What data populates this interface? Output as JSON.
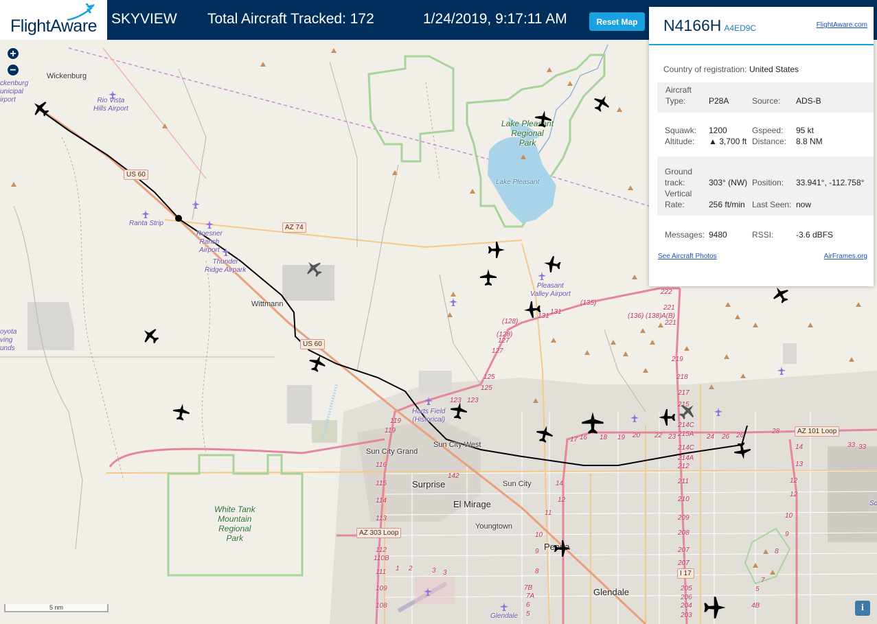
{
  "header": {
    "logo_text": "FlightAware",
    "app_name": "SKYVIEW",
    "tracked_label": "Total Aircraft Tracked: 172",
    "datetime": "1/24/2019, 9:17:11 AM",
    "reset_label": "Reset Map"
  },
  "map": {
    "zoom_in": "+",
    "zoom_out": "−",
    "scale_label": "5 nm",
    "info_label": "i",
    "places": {
      "wickenburg": "Wickenburg",
      "wickenburg_airport": "ckenburg\nunicipal\nirport",
      "rio_vista": "Rio Vista\nHills Airport",
      "lake_pleasant_park": "Lake Pleasant\nRegional\nPark",
      "lake_pleasant": "Lake Pleasant",
      "ranta": "Ranta Strip",
      "roesner": "Roesner\nRanch\nAirport",
      "thunder": "Thunder\nRidge Airpark",
      "wittmann": "Wittmann",
      "pleasant_valley": "Pleasant\nValley Airport",
      "coyota": "oyota\nving\nunds",
      "harts": "Harts Field\n(Historical)",
      "sun_city_grand": "Sun City Grand",
      "sun_city_west": "Sun City West",
      "surprise": "Surprise",
      "sun_city": "Sun City",
      "el_mirage": "El Mirage",
      "youngtown": "Youngtown",
      "white_tank": "White Tank\nMountain\nRegional\nPark",
      "peoria": "Peoria",
      "glendale": "Glendale",
      "glendale_airport": "Glendale",
      "sc": "Sc"
    },
    "shields": {
      "us60_a": "US 60",
      "az74": "AZ 74",
      "us60_b": "US 60",
      "az101": "AZ 101 Loop",
      "az303": "AZ 303 Loop",
      "i17": "I 17"
    },
    "exits": {
      "e135": "(135)",
      "e136": "(136)",
      "e138": "(138)",
      "eAB": "A(B)",
      "e131a": "131",
      "e131b": "131",
      "e128a": "(128)",
      "e128b": "(128)",
      "e127a": "127",
      "e127b": "127",
      "e125a": "125",
      "e125b": "125",
      "e123a": "123",
      "e123b": "123",
      "e119a": "119",
      "e119b": "119",
      "e116": "116",
      "e115": "115",
      "e114": "114",
      "e113": "113",
      "e112": "112",
      "e110b": "110B",
      "e111": "111",
      "e109": "109",
      "e108": "108",
      "e142": "142",
      "e1": "1",
      "e2": "2",
      "e3a": "3",
      "e3b": "3",
      "e17": "17",
      "e16": "16",
      "e18": "18",
      "e19": "19",
      "e20": "20",
      "e22": "22",
      "e23": "23",
      "e24": "24",
      "e26a": "26",
      "e26b": "26",
      "e28": "28",
      "e33a": "33",
      "e33b": "33",
      "e14a": "14",
      "e14b": "14",
      "e13": "13",
      "e12a": "12",
      "e12b": "12",
      "e10": "10",
      "e9": "9",
      "e8a": "8",
      "e7": "7",
      "e5": "5",
      "e4b": "4B",
      "e222": "222",
      "e221a": "221",
      "e221b": "221",
      "e219": "219",
      "e218": "218",
      "e217": "217",
      "e215": "215",
      "e214c": "214C",
      "e215a": "215A",
      "e214c2": "214C",
      "e214a": "214A",
      "e212": "212",
      "e211": "211",
      "e210": "210",
      "e209": "209",
      "e208": "208",
      "e207a": "207",
      "e207b": "207",
      "e206": "206",
      "e205": "205",
      "e204": "204",
      "e203": "203",
      "p14": "14",
      "p12": "12",
      "p11": "11",
      "p10": "10",
      "p9": "9",
      "p8": "8",
      "p7b": "7B",
      "p7a": "7A",
      "p6": "6",
      "p5": "5"
    }
  },
  "panel": {
    "registration": "N4166H",
    "hex": "A4ED9C",
    "fa_link": "FlightAware.com",
    "country_label": "Country of registration:",
    "country_value": "United States",
    "aircraft_type_label": "Aircraft\nType:",
    "aircraft_type_value": "P28A",
    "source_label": "Source:",
    "source_value": "ADS-B",
    "squawk_label": "Squawk:",
    "squawk_value": "1200",
    "gspeed_label": "Gspeed:",
    "gspeed_value": "95 kt",
    "altitude_label": "Altitude:",
    "altitude_value": "▲ 3,700 ft",
    "distance_label": "Distance:",
    "distance_value": "8.8 NM",
    "track_label": "Ground\ntrack:",
    "track_value": "303° (NW)",
    "position_label": "Position:",
    "position_value": "33.941°, -112.758°",
    "vrate_label": "Vertical\nRate:",
    "vrate_value": "256 ft/min",
    "lastseen_label": "Last Seen:",
    "lastseen_value": "now",
    "messages_label": "Messages:",
    "messages_value": "9480",
    "rssi_label": "RSSI:",
    "rssi_value": "-3.6 dBFS",
    "photos_link": "See Aircraft Photos",
    "airframes_link": "AirFrames.org"
  },
  "colors": {
    "header_bg": "#002f5d",
    "reset_btn": "#1aa1e1",
    "track_line": "#000000",
    "park_outline": "#9ccc8a"
  }
}
